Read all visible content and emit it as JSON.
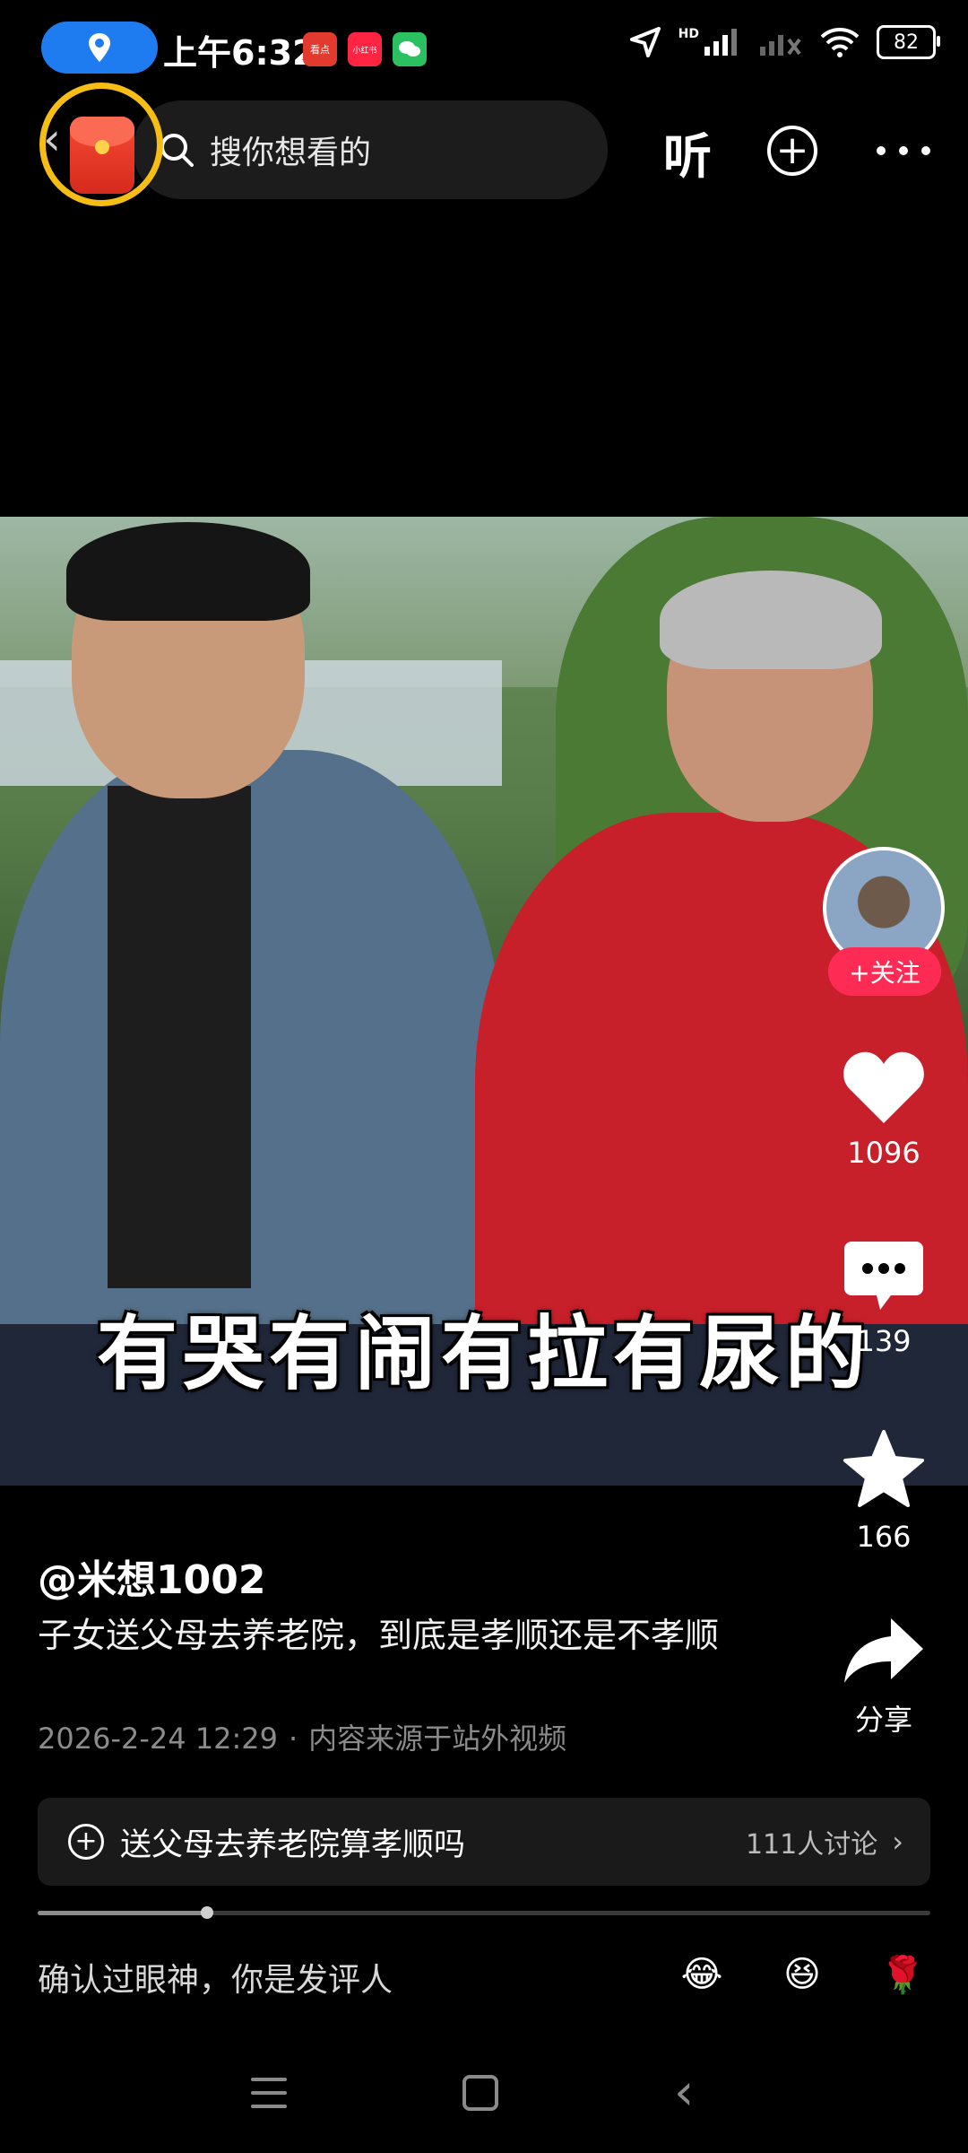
{
  "status_bar": {
    "time": "上午6:32",
    "battery": "82",
    "network_label": "HD",
    "app_badges": [
      {
        "name": "kandian-app-icon",
        "text": "看点",
        "color": "#e23a2e"
      },
      {
        "name": "xiaohongshu-app-icon",
        "text": "小红书",
        "color": "#ff2442"
      },
      {
        "name": "wechat-app-icon",
        "text": "",
        "color": "#2cc160"
      }
    ]
  },
  "top_bar": {
    "search_placeholder": "搜你想看的",
    "listen_label": "听"
  },
  "video": {
    "subtitle": "有哭有闹有拉有尿的"
  },
  "right_rail": {
    "follow_label": "+关注",
    "likes": "1096",
    "comments": "139",
    "favorites": "166",
    "share_label": "分享"
  },
  "caption": {
    "author": "@米想1002",
    "description": "子女送父母去养老院，到底是孝顺还是不孝顺",
    "date": "2026-2-24 12:29",
    "separator": "·",
    "source": "内容来源于站外视频"
  },
  "topic": {
    "title": "送父母去养老院算孝顺吗",
    "count": "111人讨论"
  },
  "progress": {
    "fraction": 0.19
  },
  "comment_bar": {
    "placeholder": "确认过眼神，你是发评人",
    "emojis": [
      "😂",
      "😆",
      "🌹"
    ]
  },
  "colors": {
    "accent": "#fe2c55",
    "redpack_ring": "#f5bd16",
    "location_pill": "#1e7bf0"
  }
}
